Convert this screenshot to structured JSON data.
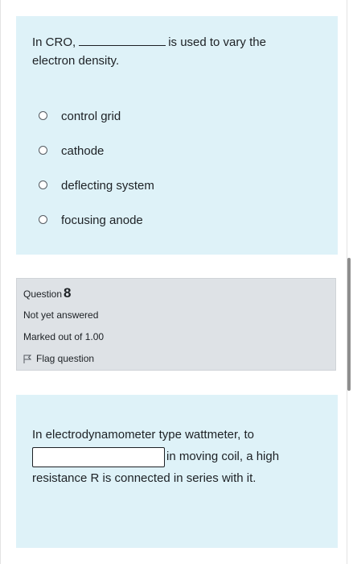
{
  "question7": {
    "text_before": "In CRO,",
    "text_after": "is used to vary the",
    "text_line2": "electron density.",
    "options": [
      {
        "label": "control grid"
      },
      {
        "label": "cathode"
      },
      {
        "label": "deflecting system"
      },
      {
        "label": "focusing anode"
      }
    ]
  },
  "question8_info": {
    "question_label": "Question",
    "question_number": "8",
    "status": "Not yet answered",
    "marked_out_of": "Marked out of 1.00",
    "flag_label": "Flag question"
  },
  "question8": {
    "line1": "In electrodynamometer type wattmeter, to",
    "input_value": "",
    "after_input": "in moving coil, a high",
    "line3": "resistance R is connected in series with it."
  },
  "colors": {
    "question_bg": "#def2f8",
    "info_bg": "#dee2e6"
  }
}
